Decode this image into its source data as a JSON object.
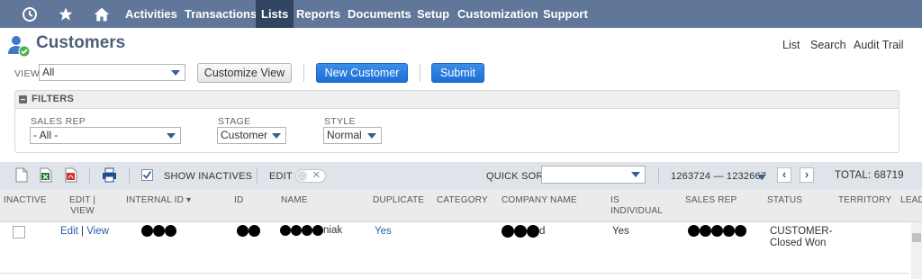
{
  "nav": {
    "items": [
      "Activities",
      "Transactions",
      "Lists",
      "Reports",
      "Documents",
      "Setup",
      "Customization",
      "Support"
    ],
    "active": "Lists",
    "icons": [
      "recent-history-icon",
      "star-icon",
      "home-icon"
    ]
  },
  "page": {
    "title": "Customers",
    "links": [
      "List",
      "Search",
      "Audit Trail"
    ]
  },
  "view": {
    "label": "VIEW",
    "value": "All",
    "customize_button": "Customize View",
    "new_button": "New Customer",
    "submit_button": "Submit"
  },
  "filters": {
    "title": "FILTERS",
    "sales_rep_label": "SALES REP",
    "sales_rep_value": "- All -",
    "stage_label": "STAGE",
    "stage_value": "Customer",
    "style_label": "STYLE",
    "style_value": "Normal"
  },
  "toolbar": {
    "show_inactives": "SHOW INACTIVES",
    "edit": "EDIT",
    "quick_sort": "QUICK SORT",
    "range": "1263724 — 1232667",
    "total": "TOTAL: 68719"
  },
  "table": {
    "headers": {
      "inactive": "INACTIVE",
      "edit_view_1": "EDIT |",
      "edit_view_2": "VIEW",
      "internal_id": "INTERNAL ID ▾",
      "id": "ID",
      "name": "NAME",
      "duplicate": "DUPLICATE",
      "category": "CATEGORY",
      "company_name": "COMPANY NAME",
      "is_individual_1": "IS",
      "is_individual_2": "INDIVIDUAL",
      "sales_rep": "SALES REP",
      "status": "STATUS",
      "territory": "TERRITORY",
      "lead": "LEAD"
    },
    "row": {
      "edit": "Edit",
      "view": "View",
      "name_tail": "niak",
      "duplicate": "Yes",
      "company_tail": "d",
      "is_individual": "Yes",
      "status_1": "CUSTOMER-",
      "status_2": "Closed Won"
    }
  },
  "colors": {
    "nav_bg": "#607799",
    "nav_active": "#2f4560",
    "primary_button": "#1d6fd8",
    "title": "#4d5f79",
    "link": "#2a5fa6"
  }
}
